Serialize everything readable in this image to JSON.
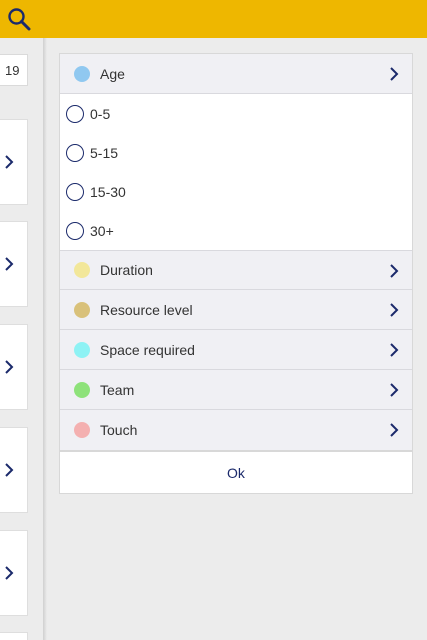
{
  "toolbar": {
    "search_icon": "search-icon",
    "accent": "#eeb700"
  },
  "background": {
    "count": "19",
    "card_icon": "chevron-right-icon"
  },
  "filters": {
    "age": {
      "label": "Age",
      "color": "#90c8f0",
      "expanded": true,
      "options": [
        "0-5",
        "5-15",
        "15-30",
        "30+"
      ]
    },
    "categories": [
      {
        "label": "Duration",
        "color": "#f2e79a"
      },
      {
        "label": "Resource level",
        "color": "#d9c17a"
      },
      {
        "label": "Space required",
        "color": "#8ef2f4"
      },
      {
        "label": "Team",
        "color": "#8ee27a"
      },
      {
        "label": "Touch",
        "color": "#f4b0b0"
      }
    ]
  },
  "ok_label": "Ok",
  "link_color": "#1b2a6b"
}
